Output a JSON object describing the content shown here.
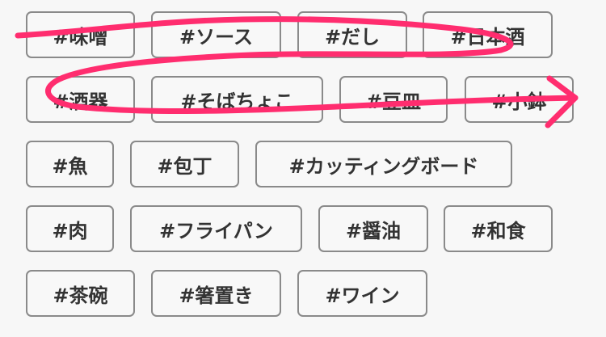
{
  "tags": [
    "#味噌",
    "#ソース",
    "#だし",
    "#日本酒",
    "#酒器",
    "#そばちょこ",
    "#豆皿",
    "#小鉢",
    "#魚",
    "#包丁",
    "#カッティングボード",
    "#肉",
    "#フライパン",
    "#醤油",
    "#和食",
    "#茶碗",
    "#箸置き",
    "#ワイン"
  ],
  "annotation": {
    "stroke_color": "#ff2d6f",
    "icon": "arrow-right-icon"
  }
}
